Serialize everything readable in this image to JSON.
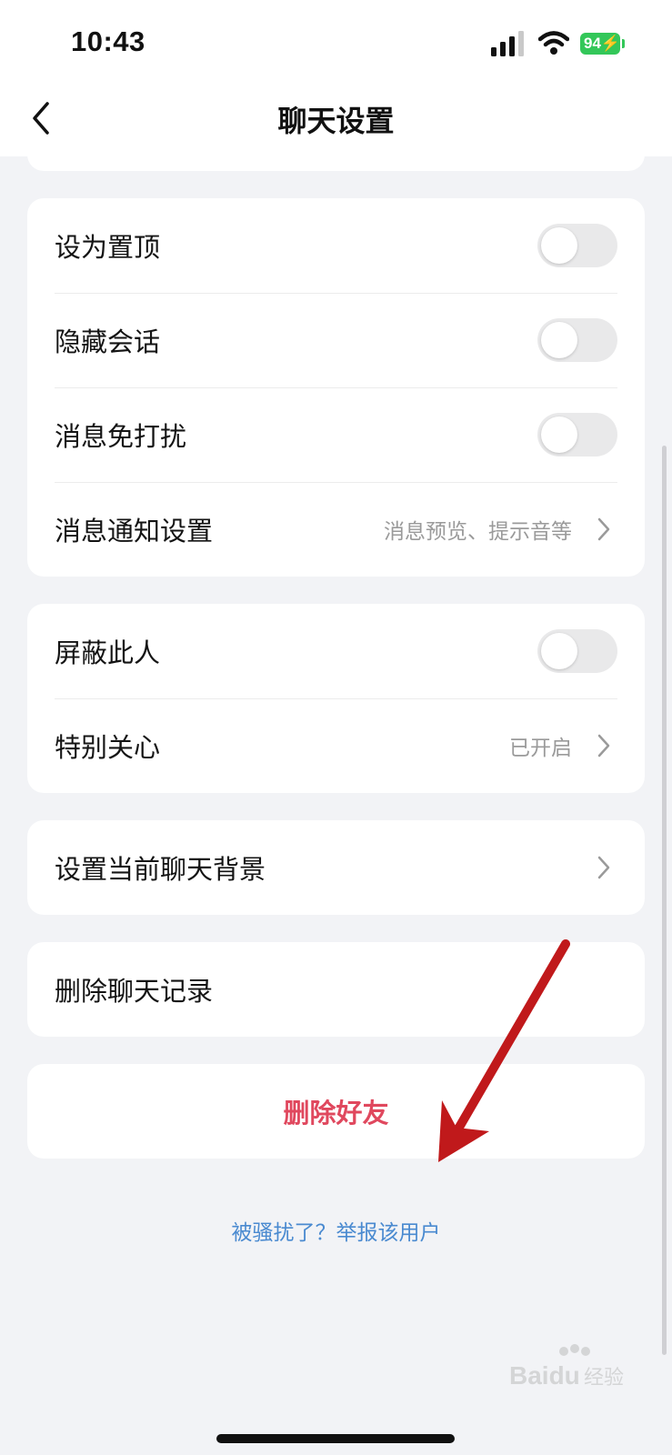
{
  "status_bar": {
    "time": "10:43",
    "battery": "94",
    "icons": [
      "cellular-signal-icon",
      "wifi-icon",
      "battery-charging-icon"
    ]
  },
  "nav": {
    "title": "聊天设置",
    "back_icon": "chevron-left-icon"
  },
  "group1": {
    "rows": [
      {
        "label": "设为置顶",
        "toggle_on": false
      },
      {
        "label": "隐藏会话",
        "toggle_on": false
      },
      {
        "label": "消息免打扰",
        "toggle_on": false
      },
      {
        "label": "消息通知设置",
        "sub": "消息预览、提示音等"
      }
    ]
  },
  "group2": {
    "rows": [
      {
        "label": "屏蔽此人",
        "toggle_on": false
      },
      {
        "label": "特别关心",
        "sub": "已开启"
      }
    ]
  },
  "group3": {
    "label": "设置当前聊天背景"
  },
  "group4": {
    "label": "删除聊天记录"
  },
  "delete_friend": {
    "label": "删除好友",
    "color": "#e0485e"
  },
  "report_link": "被骚扰了？举报该用户",
  "annotation": {
    "arrow_color": "#c0191b"
  },
  "watermark": "Baidu 经验",
  "colors": {
    "background": "#f2f3f6",
    "card": "#ffffff",
    "link": "#4a8ad0"
  }
}
